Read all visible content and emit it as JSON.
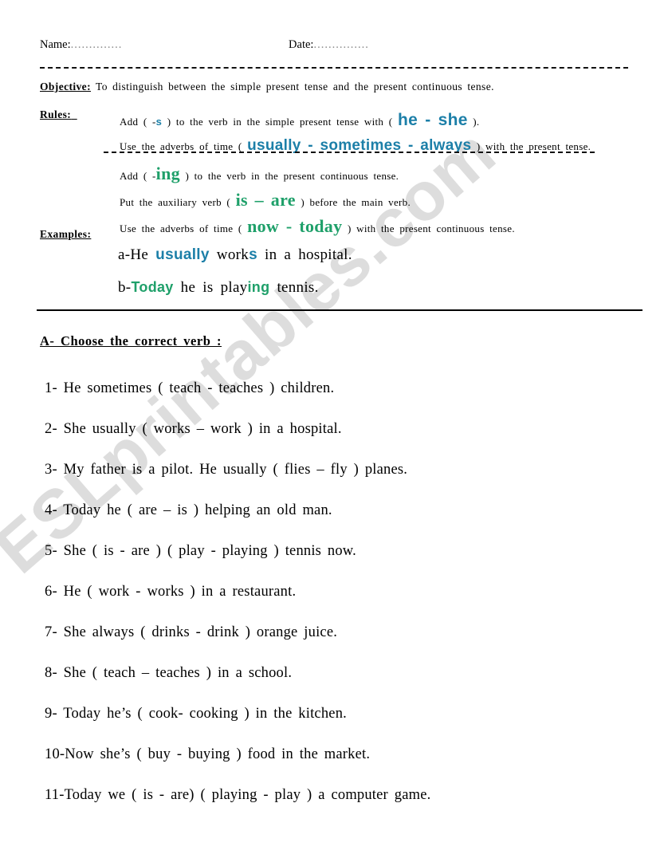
{
  "header": {
    "name_label": "Name:",
    "name_dots": "..............",
    "date_label": "Date:",
    "date_dots": "..............."
  },
  "objective": {
    "label": "Objective:",
    "text": "To  distinguish  between the simple  present  tense  and the  present  continuous  tense."
  },
  "rules": {
    "label": "Rules:",
    "simple_present": [
      {
        "before": "Add  ( -",
        "keyword": "s",
        "middle": " )   to  the  verb  in  the simple  present  tense  with  ( ",
        "keyword2": "he -  she",
        "after": " )."
      },
      {
        "before": "Use  the  adverbs  of time ( ",
        "keyword": "usually - sometimes - always",
        "after": " )  with  the  present  tense."
      }
    ],
    "present_continuous": [
      {
        "before": "Add  ( -",
        "keyword": "ing",
        "after": " ) to  the   verb  in  the  present  continuous  tense."
      },
      {
        "before": "Put   the  auxiliary  verb ( ",
        "keyword": "is – are",
        "after": " )  before  the   main  verb."
      },
      {
        "before": "Use  the  adverbs  of time ( ",
        "keyword": "now -   today",
        "after": " ) with  the present continuous  tense."
      }
    ]
  },
  "examples": {
    "label": "Examples:",
    "items": [
      {
        "prefix": "a-He  ",
        "blue1": "usually",
        "mid": "  work",
        "blue2": "s",
        "suffix": "   in a  hospital."
      },
      {
        "prefix": "b-",
        "green1": "Today",
        "mid": "  he   is   play",
        "green2": "ing",
        "suffix": " tennis."
      }
    ]
  },
  "exercise": {
    "heading": "A- Choose  the  correct  verb :",
    "questions": [
      "1- He  sometimes (  teach -  teaches )  children.",
      "2- She  usually (  works – work  )  in  a  hospital.",
      "3- My   father is a pilot. He usually  ( flies – fly ) planes.",
      "4- Today  he (  are – is ) helping  an  old  man.",
      "5- She  ( is -  are ) ( play -  playing )  tennis  now.",
      "6- He  ( work -  works ) in  a restaurant.",
      "7- She  always ( drinks  -  drink  )  orange juice.",
      "8-  She  ( teach – teaches )  in  a  school.",
      "9- Today  he’s ( cook- cooking ) in the kitchen.",
      "10-Now   she’s (  buy  -  buying )  food  in  the  market.",
      "11-Today  we  ( is - are) ( playing -  play )  a  computer  game."
    ]
  },
  "watermark": {
    "text": "ESLprintables.com"
  },
  "colors": {
    "blue": "#1c7fa8",
    "green": "#1fa06a",
    "watermark_gray": "#c9c9c9"
  }
}
